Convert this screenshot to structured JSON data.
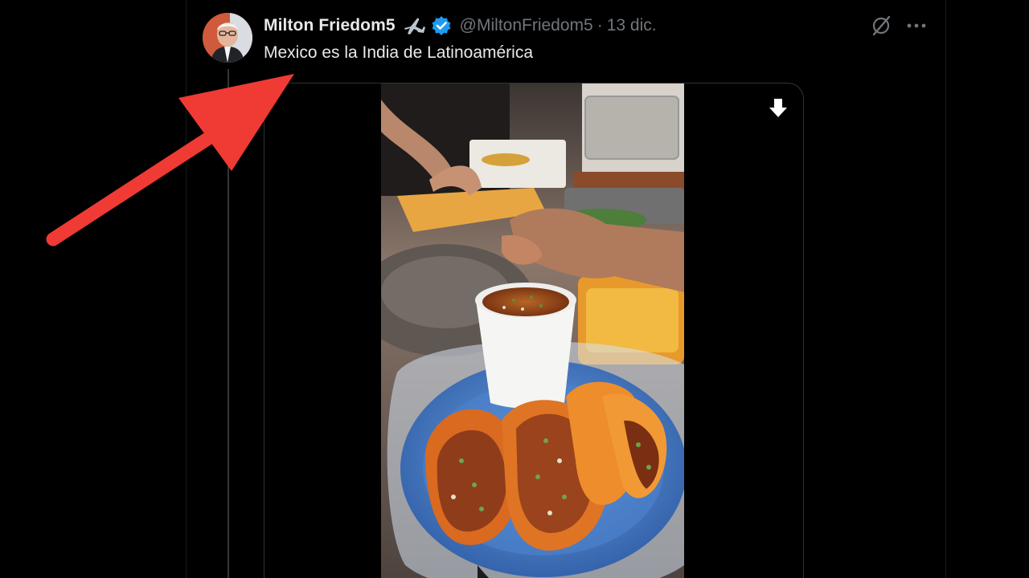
{
  "tweet": {
    "display_name": "Milton Friedom5",
    "handle": "@MiltonFriedom5",
    "separator": "·",
    "date": "13 dic.",
    "text": "Mexico es la India de Latinoamérica"
  },
  "icons": {
    "airplane": "airplane-icon",
    "verified": "verified-badge-icon",
    "grok": "grok-icon",
    "more": "more-options-icon",
    "download": "download-icon",
    "annotation": "red-arrow-annotation"
  },
  "colors": {
    "background": "#000000",
    "primary_text": "#e7e9ea",
    "secondary_text": "#71767b",
    "verified_blue": "#1d9bf0",
    "annotation_red": "#f03a34",
    "border": "#2f3336"
  }
}
